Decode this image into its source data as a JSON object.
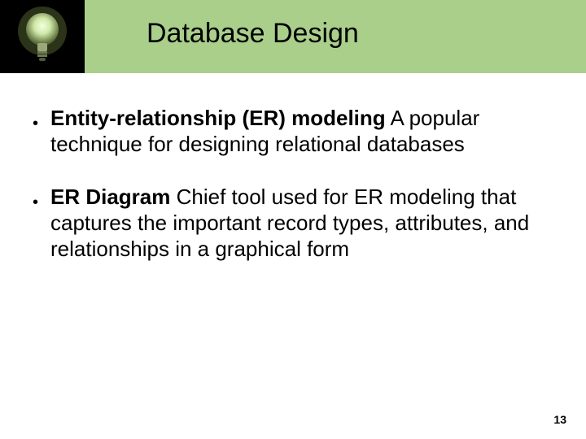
{
  "title": "Database Design",
  "bullets": [
    {
      "bold": "Entity-relationship (ER) modeling",
      "rest": "  A popular technique for designing relational databases"
    },
    {
      "bold": "ER Diagram",
      "rest": "  Chief tool used for ER modeling that captures the important record types, attributes, and relationships in a graphical form"
    }
  ],
  "page_number": "13",
  "icon": "lightbulb-icon"
}
